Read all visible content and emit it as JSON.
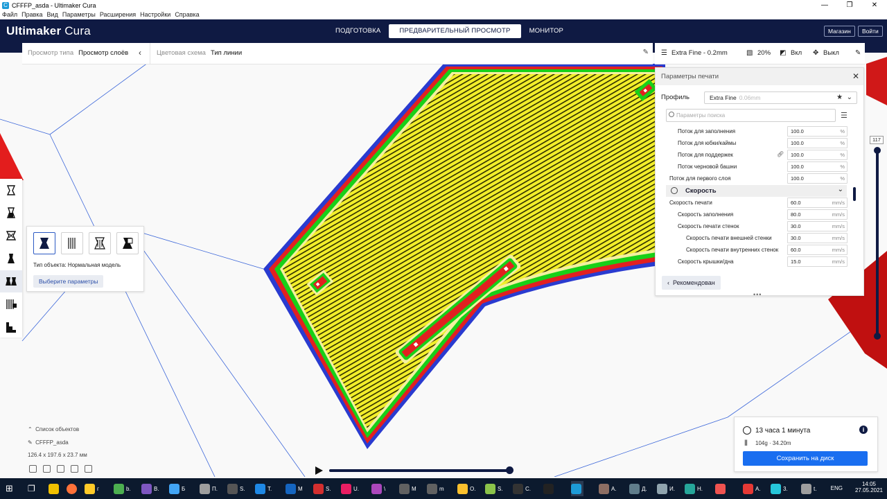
{
  "window": {
    "title": "CFFFP_asda - Ultimaker Cura",
    "controls": [
      "—",
      "❐",
      "✕"
    ]
  },
  "menu": [
    "Файл",
    "Правка",
    "Вид",
    "Параметры",
    "Расширения",
    "Настройки",
    "Справка"
  ],
  "header": {
    "logo_bold": "Ultimaker",
    "logo_light": " Cura",
    "stages": [
      "ПОДГОТОВКА",
      "ПРЕДВАРИТЕЛЬНЫЙ ПРОСМОТР",
      "МОНИТОР"
    ],
    "active_stage": "ПРЕДВАРИТЕЛЬНЫЙ ПРОСМОТР",
    "store_label": "Магазин",
    "signin_label": "Войти"
  },
  "viewbar": {
    "view_type_label": "Просмотр типа",
    "view_type_value": "Просмотр слоёв",
    "color_scheme_label": "Цветовая схема",
    "color_scheme_value": "Тип линии"
  },
  "setupbar": {
    "profile": "Extra Fine - 0.2mm",
    "infill": "20%",
    "support": "Вкл",
    "adhesion": "Выкл"
  },
  "print_settings": {
    "title": "Параметры печати",
    "profile_label": "Профиль",
    "profile_value": "Extra Fine",
    "profile_sub": "0.06mm",
    "search_placeholder": "Параметры поиска",
    "rows": [
      {
        "name": "Поток для заполнения",
        "value": "100.0",
        "unit": "%",
        "indent": 1
      },
      {
        "name": "Поток для юбки/каймы",
        "value": "100.0",
        "unit": "%",
        "indent": 1
      },
      {
        "name": "Поток для поддержек",
        "value": "100.0",
        "unit": "%",
        "indent": 1,
        "linked": true
      },
      {
        "name": "Поток черновой башни",
        "value": "100.0",
        "unit": "%",
        "indent": 1
      },
      {
        "name": "Поток для первого слоя",
        "value": "100.0",
        "unit": "%",
        "indent": 0
      }
    ],
    "category": "Скорость",
    "speed_rows": [
      {
        "name": "Скорость печати",
        "value": "60.0",
        "unit": "mm/s",
        "indent": 0
      },
      {
        "name": "Скорость заполнения",
        "value": "80.0",
        "unit": "mm/s",
        "indent": 1
      },
      {
        "name": "Скорость печати стенок",
        "value": "30.0",
        "unit": "mm/s",
        "indent": 1
      },
      {
        "name": "Скорость печати внешней стенки",
        "value": "30.0",
        "unit": "mm/s",
        "indent": 2
      },
      {
        "name": "Скорость печати внутренних стенок",
        "value": "60.0",
        "unit": "mm/s",
        "indent": 2
      },
      {
        "name": "Скорость крышки/дна",
        "value": "15.0",
        "unit": "mm/s",
        "indent": 1
      }
    ],
    "recommended_label": "Рекомендован"
  },
  "per_model": {
    "type_text": "Тип объекта: Нормальная модель",
    "select_button": "Выберите параметры"
  },
  "object_list": {
    "header": "Список объектов",
    "object_name": "CFFFP_asda",
    "dimensions": "126.4 x 197.6 x 23.7 мм"
  },
  "layer_slider": {
    "current_layer": "117",
    "position": 1.0
  },
  "playback": {
    "progress": 1.0
  },
  "print_info": {
    "time": "13 часа 1 минута",
    "material": "104g · 34.20m",
    "save_button": "Сохранить на диск"
  },
  "taskbar": {
    "items": [
      {
        "label": "b.",
        "color": "#4caf50"
      },
      {
        "label": "В.",
        "color": "#7e57c2"
      },
      {
        "label": "Б",
        "color": "#42a5f5"
      },
      {
        "label": "П.",
        "color": "#9e9e9e"
      },
      {
        "label": "S.",
        "color": "#555555"
      },
      {
        "label": "T.",
        "color": "#1e88e5"
      },
      {
        "label": "M",
        "color": "#1565c0"
      },
      {
        "label": "S.",
        "color": "#d32f2f"
      },
      {
        "label": "U.",
        "color": "#e91e63"
      },
      {
        "label": "\\",
        "color": "#ab47bc"
      },
      {
        "label": "M",
        "color": "#616161"
      },
      {
        "label": "m",
        "color": "#616161"
      },
      {
        "label": "O.",
        "color": "#fbc02d"
      },
      {
        "label": "S.",
        "color": "#8bc34a"
      },
      {
        "label": "C.",
        "color": "#333333"
      },
      {
        "label": "",
        "color": "#222222"
      },
      {
        "label": "",
        "color": "#1d9bd7"
      },
      {
        "label": "A.",
        "color": "#8d6e63"
      },
      {
        "label": "Д.",
        "color": "#607d8b"
      },
      {
        "label": "И.",
        "color": "#90a4ae"
      },
      {
        "label": "Н.",
        "color": "#26a69a"
      },
      {
        "label": "",
        "color": "#ef5350"
      },
      {
        "label": "A.",
        "color": "#e53935"
      },
      {
        "label": "3.",
        "color": "#26c6da"
      },
      {
        "label": "t.",
        "color": "#9e9e9e"
      }
    ],
    "lang": "ENG",
    "time": "14:05",
    "date": "27.05.2021"
  }
}
